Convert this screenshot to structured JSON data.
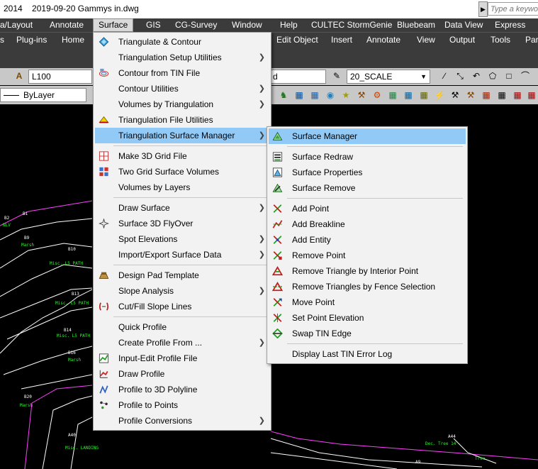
{
  "window": {
    "title_prefix": "2014",
    "title_file": "2019-09-20 Gammys in.dwg",
    "search_placeholder": "Type a keyword"
  },
  "menubar": [
    "a/Layout",
    "Annotate",
    "Surface",
    "GIS",
    "CG-Survey",
    "Window",
    "Help",
    "CULTEC StormGenie",
    "Bluebeam",
    "Data View",
    "Express"
  ],
  "ribbon_tabs": [
    "s",
    "Plug-ins",
    "Home",
    "Edit Object",
    "Insert",
    "Annotate",
    "View",
    "Output",
    "Tools",
    "Par"
  ],
  "toolbar": {
    "layer_value": "L100",
    "linetype_value": "ByLayer",
    "dimstyle_value": "d",
    "scale_value": "20_SCALE"
  },
  "surface_menu": {
    "items": [
      {
        "label": "Triangulate & Contour",
        "icon": "triangulate-icon",
        "submenu": false
      },
      {
        "label": "Triangulation Setup Utilities",
        "icon": "",
        "submenu": true
      },
      {
        "label": "Contour from TIN File",
        "icon": "contour-icon",
        "submenu": false
      },
      {
        "label": "Contour Utilities",
        "icon": "",
        "submenu": true
      },
      {
        "label": "Volumes by Triangulation",
        "icon": "",
        "submenu": true
      },
      {
        "label": "Triangulation File Utilities",
        "icon": "tin-file-icon",
        "submenu": false
      },
      {
        "label": "Triangulation Surface Manager",
        "icon": "",
        "submenu": true
      },
      {
        "label": "Make 3D Grid File",
        "icon": "grid-icon",
        "submenu": false
      },
      {
        "label": "Two Grid Surface Volumes",
        "icon": "two-grid-icon",
        "submenu": false
      },
      {
        "label": "Volumes by Layers",
        "icon": "",
        "submenu": false
      },
      {
        "label": "Draw Surface",
        "icon": "",
        "submenu": true
      },
      {
        "label": "Surface 3D FlyOver",
        "icon": "flyover-icon",
        "submenu": false
      },
      {
        "label": "Spot Elevations",
        "icon": "",
        "submenu": true
      },
      {
        "label": "Import/Export Surface Data",
        "icon": "",
        "submenu": true
      },
      {
        "label": "Design Pad Template",
        "icon": "pad-icon",
        "submenu": false
      },
      {
        "label": "Slope Analysis",
        "icon": "",
        "submenu": true
      },
      {
        "label": "Cut/Fill Slope Lines",
        "icon": "cutfill-icon",
        "submenu": false
      },
      {
        "label": "Quick Profile",
        "icon": "",
        "submenu": false
      },
      {
        "label": "Create Profile From ...",
        "icon": "",
        "submenu": true
      },
      {
        "label": "Input-Edit Profile File",
        "icon": "profile-edit-icon",
        "submenu": false
      },
      {
        "label": "Draw Profile",
        "icon": "draw-profile-icon",
        "submenu": false
      },
      {
        "label": "Profile to 3D Polyline",
        "icon": "polyline-icon",
        "submenu": false
      },
      {
        "label": "Profile to Points",
        "icon": "points-icon",
        "submenu": false
      },
      {
        "label": "Profile Conversions",
        "icon": "",
        "submenu": true
      }
    ]
  },
  "surface_manager_menu": {
    "items": [
      {
        "label": "Surface Manager",
        "icon": "surface-manager-icon"
      },
      {
        "label": "Surface Redraw",
        "icon": "surface-redraw-icon"
      },
      {
        "label": "Surface Properties",
        "icon": "surface-properties-icon"
      },
      {
        "label": "Surface Remove",
        "icon": "surface-remove-icon"
      },
      {
        "label": "Add Point",
        "icon": "add-point-icon"
      },
      {
        "label": "Add Breakline",
        "icon": "add-breakline-icon"
      },
      {
        "label": "Add Entity",
        "icon": "add-entity-icon"
      },
      {
        "label": "Remove Point",
        "icon": "remove-point-icon"
      },
      {
        "label": "Remove Triangle by Interior Point",
        "icon": "remove-triangle-icon"
      },
      {
        "label": "Remove Triangles by Fence Selection",
        "icon": "remove-fence-icon"
      },
      {
        "label": "Move Point",
        "icon": "move-point-icon"
      },
      {
        "label": "Set Point Elevation",
        "icon": "set-elevation-icon"
      },
      {
        "label": "Swap TIN Edge",
        "icon": "swap-edge-icon"
      },
      {
        "label": "Display Last TIN Error Log",
        "icon": ""
      }
    ]
  },
  "drawing_labels": [
    {
      "text": "B2"
    },
    {
      "text": "B1"
    },
    {
      "text": "NLV"
    },
    {
      "text": "B9"
    },
    {
      "text": "Marsh"
    },
    {
      "text": "B10"
    },
    {
      "text": "Misc. L5 PATH"
    },
    {
      "text": "B13"
    },
    {
      "text": "Misc. L5 PATH"
    },
    {
      "text": "B14"
    },
    {
      "text": "Misc. L5 PATH"
    },
    {
      "text": "B16"
    },
    {
      "text": "Marsh"
    },
    {
      "text": "B20"
    },
    {
      "text": "Marsh"
    },
    {
      "text": "A40"
    },
    {
      "text": "Misc. LANDING"
    },
    {
      "text": "A44"
    },
    {
      "text": "Dec. Tree 14\""
    },
    {
      "text": "A9"
    },
    {
      "text": "Tree"
    }
  ]
}
